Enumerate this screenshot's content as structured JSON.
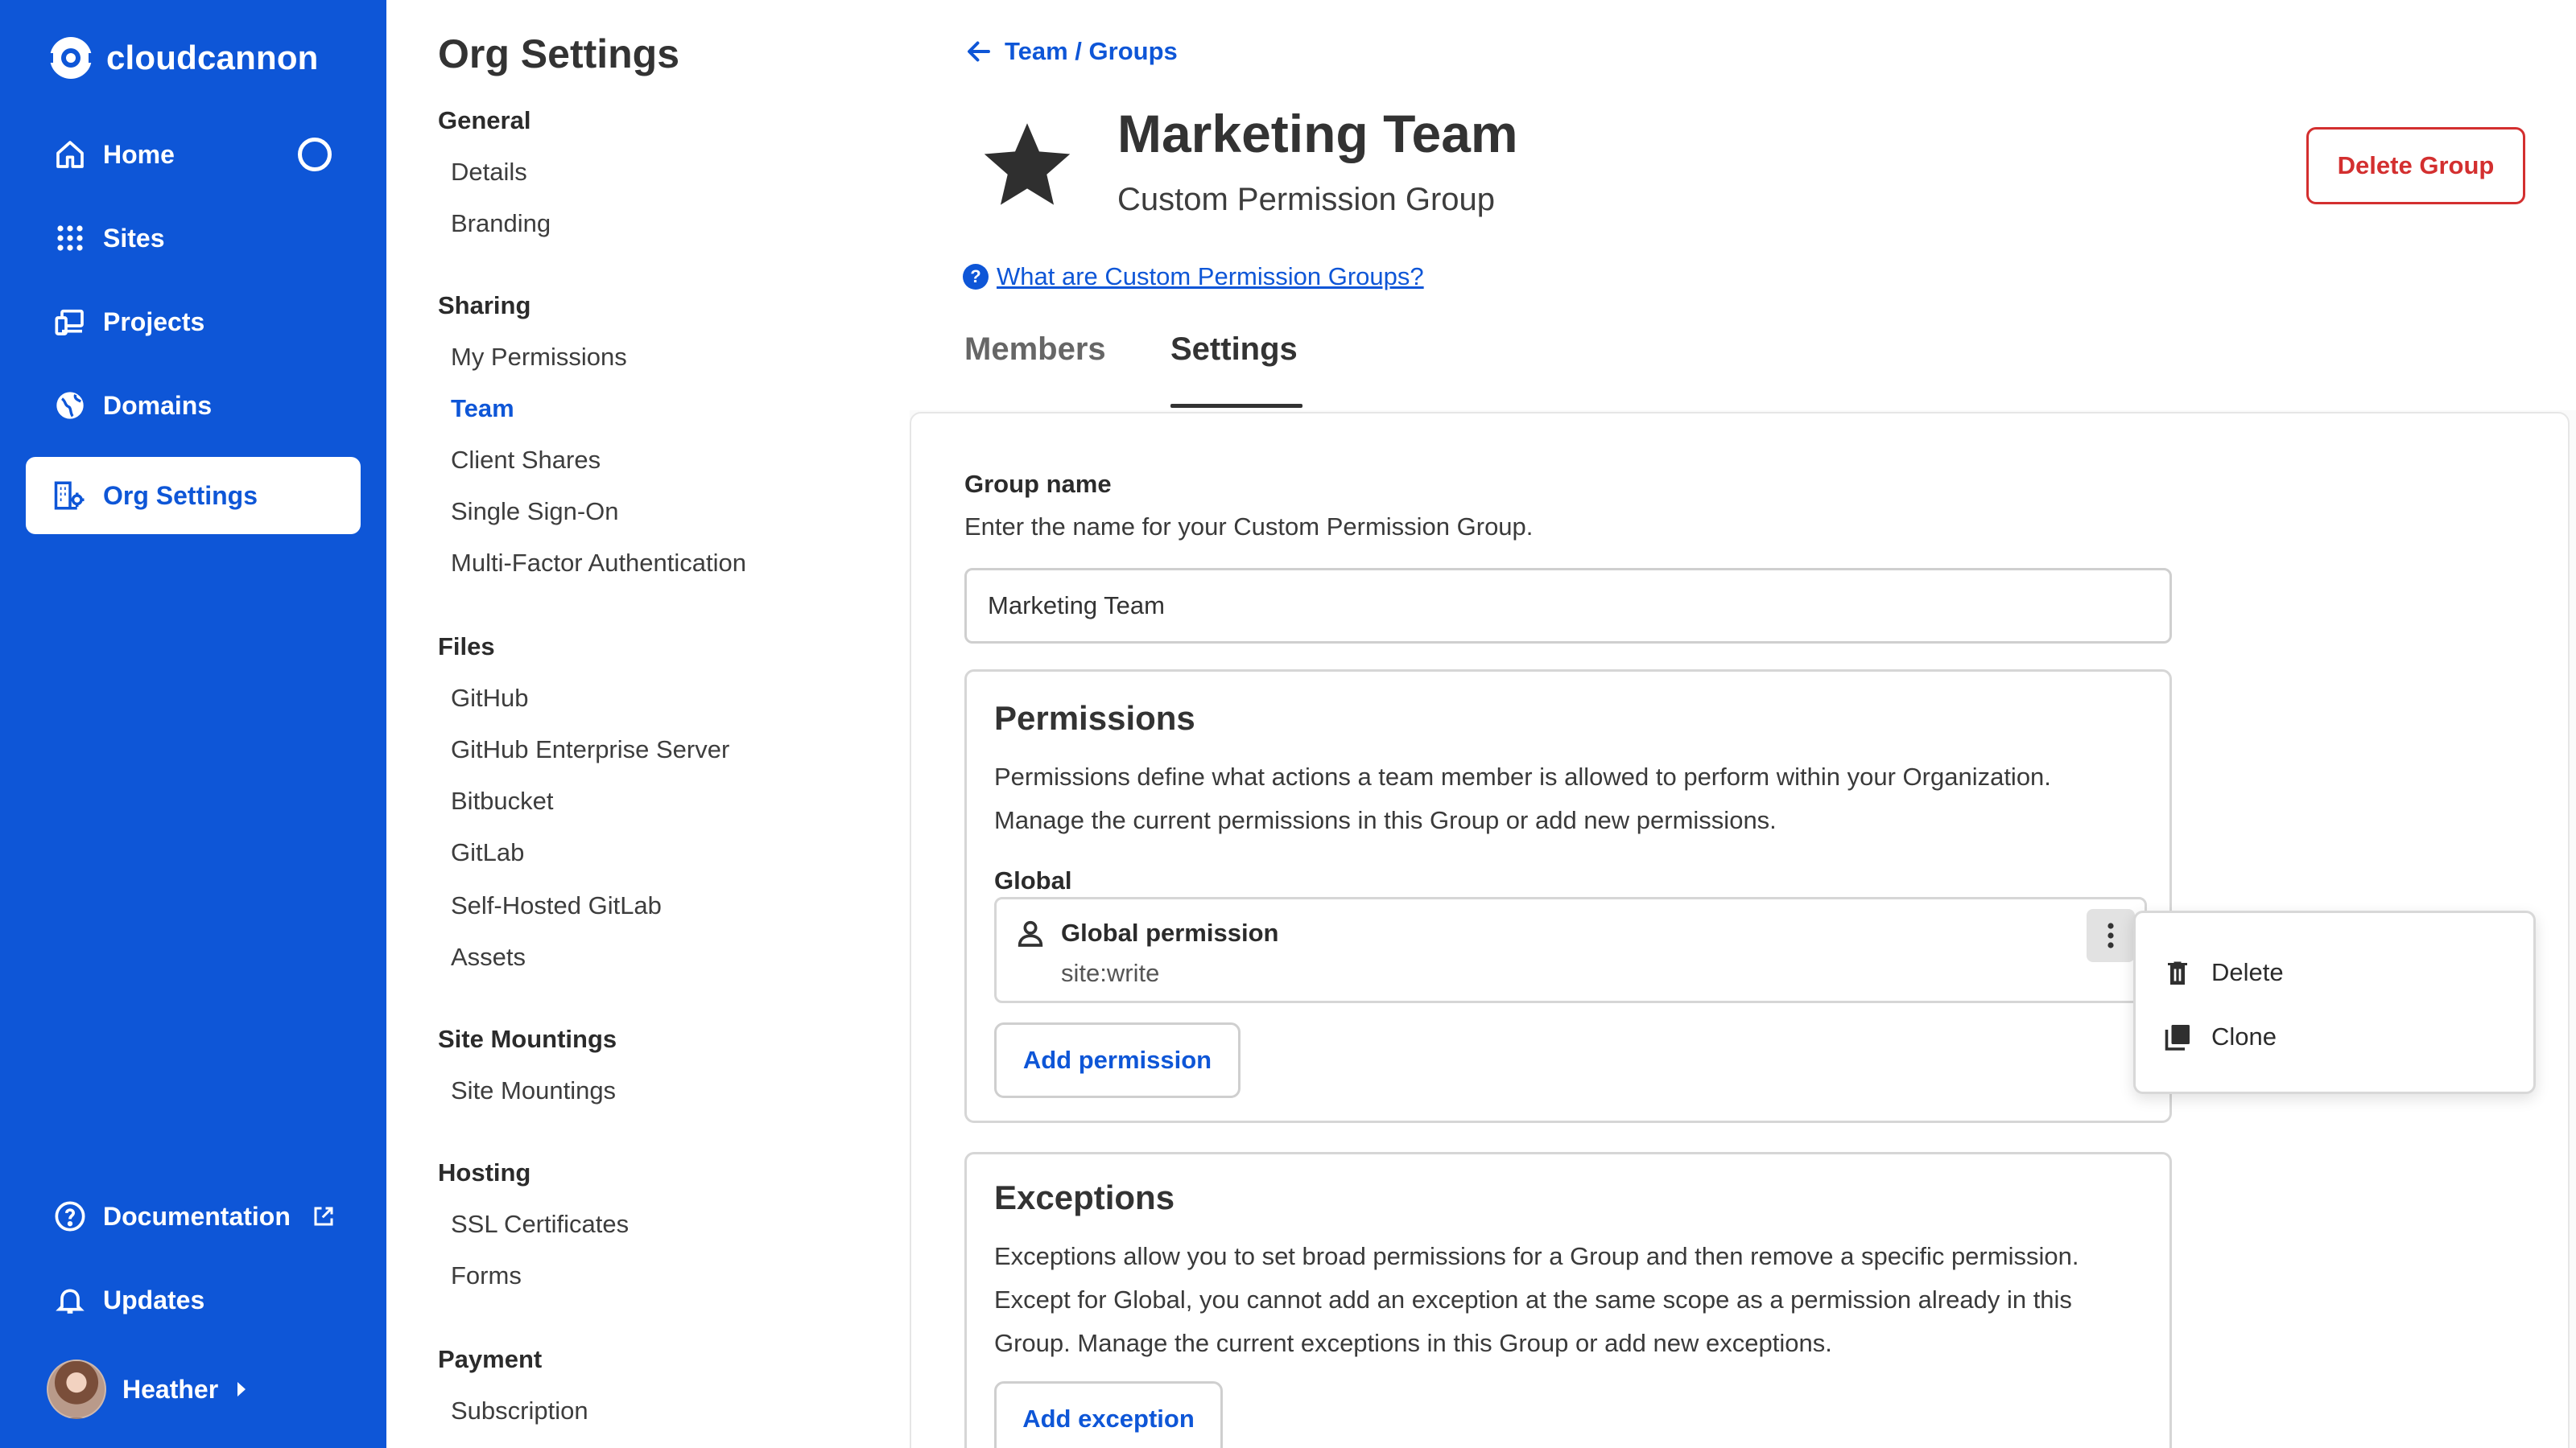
{
  "app": {
    "brand": "cloudcannon"
  },
  "nav": {
    "items": [
      {
        "label": "Home",
        "icon": "home-icon"
      },
      {
        "label": "Sites",
        "icon": "grid-icon"
      },
      {
        "label": "Projects",
        "icon": "devices-icon"
      },
      {
        "label": "Domains",
        "icon": "globe-icon"
      },
      {
        "label": "Org Settings",
        "icon": "org-settings-icon",
        "active": true
      }
    ],
    "footer": [
      {
        "label": "Documentation",
        "icon": "help-circle-icon"
      },
      {
        "label": "Updates",
        "icon": "bell-icon"
      }
    ],
    "user": {
      "name": "Heather"
    }
  },
  "settings_sidebar": {
    "title": "Org Settings",
    "sections": [
      {
        "heading": "General",
        "links": [
          "Details",
          "Branding"
        ]
      },
      {
        "heading": "Sharing",
        "links": [
          "My Permissions",
          "Team",
          "Client Shares",
          "Single Sign-On",
          "Multi-Factor Authentication"
        ],
        "current": "Team"
      },
      {
        "heading": "Files",
        "links": [
          "GitHub",
          "GitHub Enterprise Server",
          "Bitbucket",
          "GitLab",
          "Self-Hosted GitLab",
          "Assets"
        ]
      },
      {
        "heading": "Site Mountings",
        "links": [
          "Site Mountings"
        ]
      },
      {
        "heading": "Hosting",
        "links": [
          "SSL Certificates",
          "Forms"
        ]
      },
      {
        "heading": "Payment",
        "links": [
          "Subscription"
        ]
      }
    ]
  },
  "main": {
    "breadcrumb": "Team / Groups",
    "title": "Marketing Team",
    "subtitle": "Custom Permission Group",
    "delete_button": "Delete Group",
    "help_link": "What are Custom Permission Groups?",
    "help_glyph": "?",
    "tabs": [
      {
        "label": "Members",
        "active": false
      },
      {
        "label": "Settings",
        "active": true
      }
    ],
    "group_name": {
      "label": "Group name",
      "description": "Enter the name for your Custom Permission Group.",
      "value": "Marketing Team"
    },
    "permissions": {
      "title": "Permissions",
      "description_line1": "Permissions define what actions a team member is allowed to perform within your Organization.",
      "description_line2": "Manage the current permissions in this Group or add new permissions.",
      "scope_label": "Global",
      "entry": {
        "name": "Global permission",
        "value": "site:write"
      },
      "add_button": "Add permission"
    },
    "exceptions": {
      "title": "Exceptions",
      "description_line1": "Exceptions allow you to set broad permissions for a Group and then remove a specific permission.",
      "description_line2": "Except for Global, you cannot add an exception at the same scope as a permission already in this",
      "description_line3": "Group. Manage the current exceptions in this Group or add new exceptions.",
      "add_button": "Add exception"
    },
    "context_menu": [
      {
        "label": "Delete",
        "icon": "trash-icon"
      },
      {
        "label": "Clone",
        "icon": "copy-icon"
      }
    ]
  },
  "colors": {
    "brand": "#0e56d7",
    "danger": "#d32f2f",
    "border": "#d6d6d6"
  }
}
